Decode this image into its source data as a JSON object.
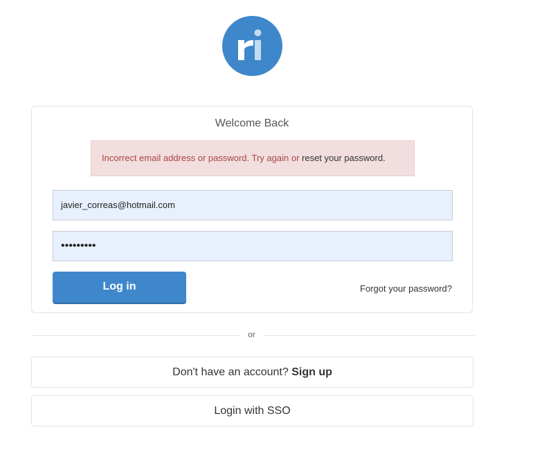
{
  "logo": {
    "text": "ri",
    "color": "#3f87cb"
  },
  "login_card": {
    "title": "Welcome Back",
    "error": {
      "message": "Incorrect email address or password. Try again or",
      "link_text": "reset your password."
    },
    "email_value": "javier_correas@hotmail.com",
    "password_value": "•••••••••",
    "login_button": "Log in",
    "forgot_link": "Forgot your password?"
  },
  "divider_text": "or",
  "signup": {
    "prompt": "Don't have an account?",
    "link": "Sign up"
  },
  "sso_button": "Login with SSO",
  "colors": {
    "accent": "#3f87cb",
    "error_bg": "#f2dede",
    "error_text": "#a94442",
    "input_bg": "#e8f0fe"
  }
}
